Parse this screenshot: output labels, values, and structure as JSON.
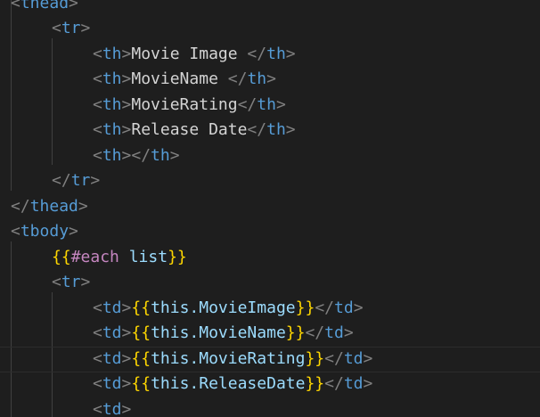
{
  "editor": {
    "lines": [
      [
        {
          "t": "punct",
          "v": "<"
        },
        {
          "t": "tag",
          "v": "thead"
        },
        {
          "t": "punct",
          "v": ">"
        }
      ],
      [
        {
          "t": "punct",
          "v": "<"
        },
        {
          "t": "tag",
          "v": "tr"
        },
        {
          "t": "punct",
          "v": ">"
        }
      ],
      [
        {
          "t": "punct",
          "v": "<"
        },
        {
          "t": "tag",
          "v": "th"
        },
        {
          "t": "punct",
          "v": ">"
        },
        {
          "t": "text",
          "v": "Movie Image "
        },
        {
          "t": "punct",
          "v": "</"
        },
        {
          "t": "tag",
          "v": "th"
        },
        {
          "t": "punct",
          "v": ">"
        }
      ],
      [
        {
          "t": "punct",
          "v": "<"
        },
        {
          "t": "tag",
          "v": "th"
        },
        {
          "t": "punct",
          "v": ">"
        },
        {
          "t": "text",
          "v": "MovieName "
        },
        {
          "t": "punct",
          "v": "</"
        },
        {
          "t": "tag",
          "v": "th"
        },
        {
          "t": "punct",
          "v": ">"
        }
      ],
      [
        {
          "t": "punct",
          "v": "<"
        },
        {
          "t": "tag",
          "v": "th"
        },
        {
          "t": "punct",
          "v": ">"
        },
        {
          "t": "text",
          "v": "MovieRating"
        },
        {
          "t": "punct",
          "v": "</"
        },
        {
          "t": "tag",
          "v": "th"
        },
        {
          "t": "punct",
          "v": ">"
        }
      ],
      [
        {
          "t": "punct",
          "v": "<"
        },
        {
          "t": "tag",
          "v": "th"
        },
        {
          "t": "punct",
          "v": ">"
        },
        {
          "t": "text",
          "v": "Release Date"
        },
        {
          "t": "punct",
          "v": "</"
        },
        {
          "t": "tag",
          "v": "th"
        },
        {
          "t": "punct",
          "v": ">"
        }
      ],
      [
        {
          "t": "punct",
          "v": "<"
        },
        {
          "t": "tag",
          "v": "th"
        },
        {
          "t": "punct",
          "v": "></"
        },
        {
          "t": "tag",
          "v": "th"
        },
        {
          "t": "punct",
          "v": ">"
        }
      ],
      [
        {
          "t": "punct",
          "v": "</"
        },
        {
          "t": "tag",
          "v": "tr"
        },
        {
          "t": "punct",
          "v": ">"
        }
      ],
      [
        {
          "t": "punct",
          "v": "</"
        },
        {
          "t": "tag",
          "v": "thead"
        },
        {
          "t": "punct",
          "v": ">"
        }
      ],
      [
        {
          "t": "punct",
          "v": "<"
        },
        {
          "t": "tag",
          "v": "tbody"
        },
        {
          "t": "punct",
          "v": ">"
        }
      ],
      [
        {
          "t": "brace",
          "v": "{{"
        },
        {
          "t": "keyword",
          "v": "#each"
        },
        {
          "t": "text",
          "v": " "
        },
        {
          "t": "var",
          "v": "list"
        },
        {
          "t": "brace",
          "v": "}}"
        }
      ],
      [
        {
          "t": "punct",
          "v": "<"
        },
        {
          "t": "tag",
          "v": "tr"
        },
        {
          "t": "punct",
          "v": ">"
        }
      ],
      [
        {
          "t": "punct",
          "v": "<"
        },
        {
          "t": "tag",
          "v": "td"
        },
        {
          "t": "punct",
          "v": ">"
        },
        {
          "t": "brace",
          "v": "{{"
        },
        {
          "t": "var",
          "v": "this.MovieImage"
        },
        {
          "t": "brace",
          "v": "}}"
        },
        {
          "t": "punct",
          "v": "</"
        },
        {
          "t": "tag",
          "v": "td"
        },
        {
          "t": "punct",
          "v": ">"
        }
      ],
      [
        {
          "t": "punct",
          "v": "<"
        },
        {
          "t": "tag",
          "v": "td"
        },
        {
          "t": "punct",
          "v": ">"
        },
        {
          "t": "brace",
          "v": "{{"
        },
        {
          "t": "var",
          "v": "this.MovieName"
        },
        {
          "t": "brace",
          "v": "}}"
        },
        {
          "t": "punct",
          "v": "</"
        },
        {
          "t": "tag",
          "v": "td"
        },
        {
          "t": "punct",
          "v": ">"
        }
      ],
      [
        {
          "t": "punct",
          "v": "<"
        },
        {
          "t": "tag",
          "v": "td"
        },
        {
          "t": "punct",
          "v": ">"
        },
        {
          "t": "brace",
          "v": "{{"
        },
        {
          "t": "var",
          "v": "this.MovieRating"
        },
        {
          "t": "brace",
          "v": "}}"
        },
        {
          "t": "punct",
          "v": "</"
        },
        {
          "t": "tag",
          "v": "td"
        },
        {
          "t": "punct",
          "v": ">"
        }
      ],
      [
        {
          "t": "punct",
          "v": "<"
        },
        {
          "t": "tag",
          "v": "td"
        },
        {
          "t": "punct",
          "v": ">"
        },
        {
          "t": "brace",
          "v": "{{"
        },
        {
          "t": "var",
          "v": "this.ReleaseDate"
        },
        {
          "t": "brace",
          "v": "}}"
        },
        {
          "t": "punct",
          "v": "</"
        },
        {
          "t": "tag",
          "v": "td"
        },
        {
          "t": "punct",
          "v": ">"
        }
      ],
      [
        {
          "t": "punct",
          "v": "<"
        },
        {
          "t": "tag",
          "v": "td"
        },
        {
          "t": "punct",
          "v": ">"
        }
      ]
    ],
    "colors": {
      "background": "#1e1e1e",
      "punctuation": "#808080",
      "tag": "#569cd6",
      "text": "#d4d4d4",
      "brace": "#ffd700",
      "keyword": "#c586c0",
      "variable": "#9cdcfe"
    }
  }
}
